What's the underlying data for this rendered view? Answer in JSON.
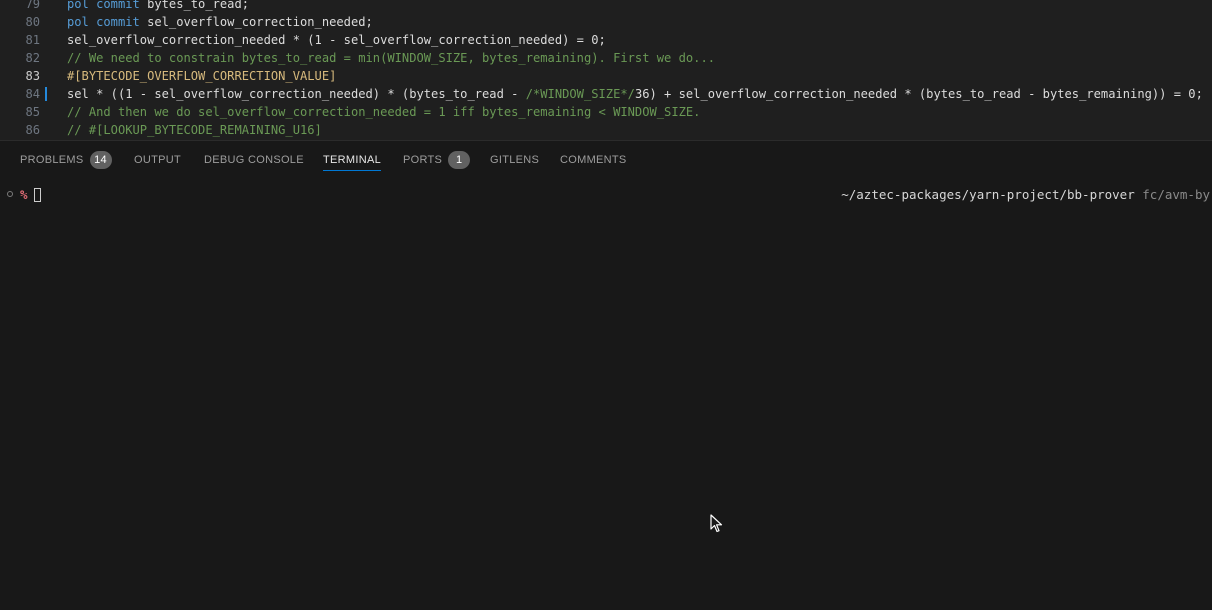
{
  "editor": {
    "lines": [
      {
        "no": "79",
        "tokens": [
          [
            "kw",
            "pol"
          ],
          [
            "op",
            " "
          ],
          [
            "kw",
            "commit"
          ],
          [
            "ident",
            " bytes_to_read;"
          ]
        ]
      },
      {
        "no": "80",
        "tokens": [
          [
            "kw",
            "pol"
          ],
          [
            "op",
            " "
          ],
          [
            "kw",
            "commit"
          ],
          [
            "ident",
            " sel_overflow_correction_needed;"
          ]
        ]
      },
      {
        "no": "81",
        "tokens": [
          [
            "ident",
            "sel_overflow_correction_needed * (1 - sel_overflow_correction_needed) = 0;"
          ]
        ]
      },
      {
        "no": "82",
        "tokens": [
          [
            "cmt",
            "// We need to constrain bytes_to_read = min(WINDOW_SIZE, bytes_remaining). First we do..."
          ]
        ]
      },
      {
        "no": "83",
        "active": true,
        "tokens": [
          [
            "tag",
            "#[BYTECODE_OVERFLOW_CORRECTION_VALUE]"
          ]
        ]
      },
      {
        "no": "84",
        "modified": true,
        "tokens": [
          [
            "ident",
            "sel * ((1 - sel_overflow_correction_needed) * (bytes_to_read - "
          ],
          [
            "cmt",
            "/*WINDOW_SIZE*/"
          ],
          [
            "ident",
            "36) + sel_overflow_correction_needed * (bytes_to_read - bytes_remaining)) = 0;"
          ]
        ]
      },
      {
        "no": "85",
        "tokens": [
          [
            "cmt",
            "// And then we do sel_overflow_correction_needed = 1 iff bytes_remaining < WINDOW_SIZE."
          ]
        ]
      },
      {
        "no": "86",
        "tokens": [
          [
            "cmt",
            "// #[LOOKUP_BYTECODE_REMAINING_U16]"
          ]
        ]
      }
    ]
  },
  "panel": {
    "tabs": [
      {
        "label": "PROBLEMS",
        "badge": "14"
      },
      {
        "label": "OUTPUT"
      },
      {
        "label": "DEBUG CONSOLE"
      },
      {
        "label": "TERMINAL",
        "active": true
      },
      {
        "label": "PORTS",
        "badge": "1"
      },
      {
        "label": "GITLENS"
      },
      {
        "label": "COMMENTS"
      }
    ]
  },
  "terminal": {
    "prompt_symbol": "%",
    "cwd": "~/aztec-packages/yarn-project/bb-prover",
    "branch": "fc/avm-by"
  },
  "icons": {
    "status": "circle-status-icon",
    "cursor": "mouse-pointer-icon"
  },
  "colors": {
    "accent": "#0078d4",
    "prompt": "#e06c75",
    "background": "#181818"
  }
}
